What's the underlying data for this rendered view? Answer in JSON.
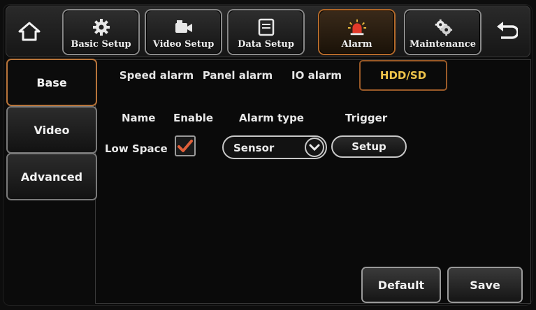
{
  "toolbar": {
    "home_icon": "home-icon",
    "back_icon": "back-arrow-icon",
    "tabs": [
      {
        "label": "Basic Setup",
        "icon": "gear-icon"
      },
      {
        "label": "Video Setup",
        "icon": "camera-icon"
      },
      {
        "label": "Data Setup",
        "icon": "storage-icon"
      },
      {
        "label": "Alarm",
        "icon": "alarm-siren-icon",
        "active": true
      },
      {
        "label": "Maintenance",
        "icon": "gears-icon"
      }
    ]
  },
  "sidebar": {
    "items": [
      {
        "label": "Base",
        "active": true
      },
      {
        "label": "Video"
      },
      {
        "label": "Advanced"
      }
    ]
  },
  "subtabs": [
    {
      "label": "Speed alarm"
    },
    {
      "label": "Panel alarm"
    },
    {
      "label": "IO alarm"
    },
    {
      "label": "HDD/SD",
      "active": true
    }
  ],
  "table": {
    "headers": {
      "name": "Name",
      "enable": "Enable",
      "alarm_type": "Alarm type",
      "trigger": "Trigger"
    },
    "rows": [
      {
        "name": "Low Space",
        "enable": true,
        "alarm_type": "Sensor",
        "trigger": "Setup"
      }
    ]
  },
  "footer": {
    "default_label": "Default",
    "save_label": "Save"
  },
  "colors": {
    "active_accent": "#b8743a",
    "active_subtab_text": "#f0c44a",
    "check_color": "#e0603a"
  }
}
